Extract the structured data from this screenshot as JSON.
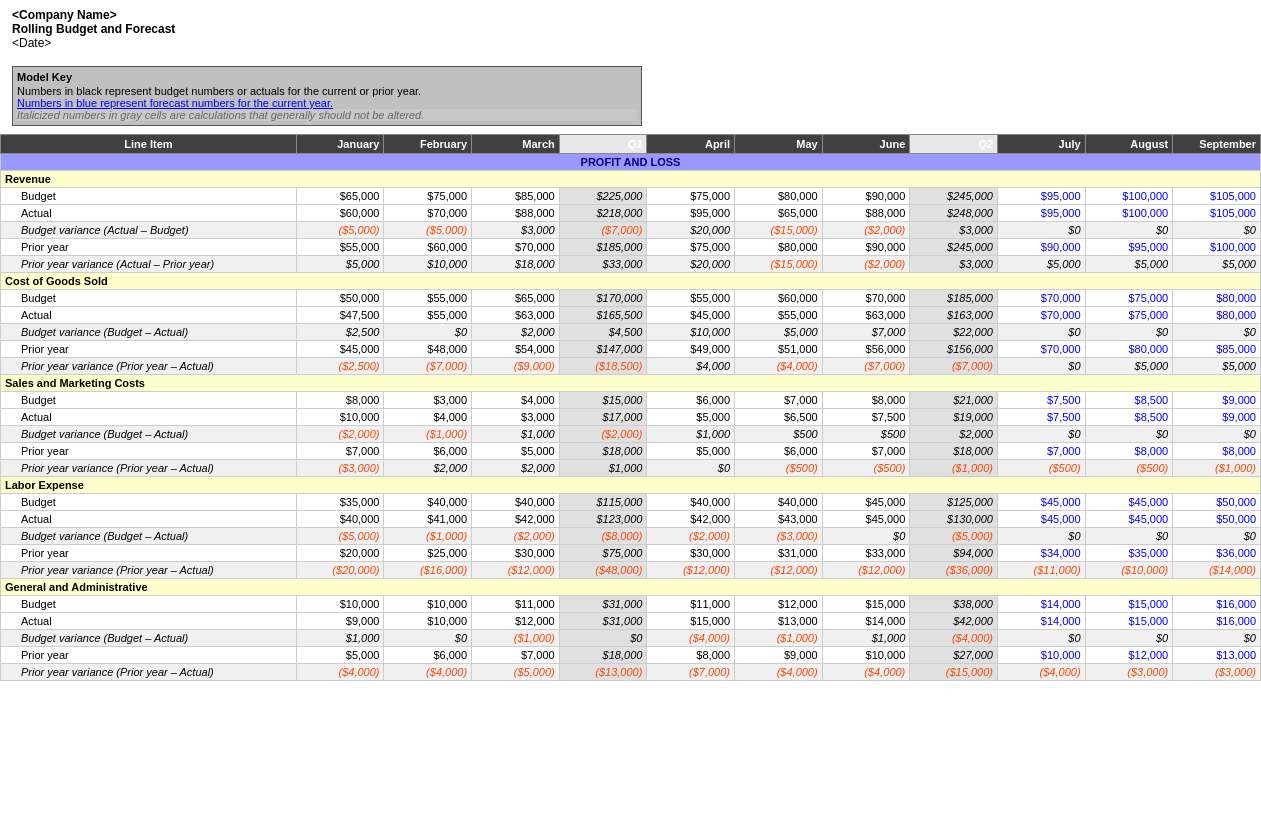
{
  "header": {
    "company": "<Company Name>",
    "title": "Rolling Budget and Forecast",
    "date": "<Date>"
  },
  "modelKey": {
    "title": "Model Key",
    "line1": "Numbers in black represent budget numbers or actuals for the current or prior year.",
    "line2": "Numbers in blue represent forecast numbers for the current year.",
    "line3": "Italicized numbers in gray cells are calculations that generally should not be altered."
  },
  "columns": [
    "Line Item",
    "January",
    "February",
    "March",
    "Q1",
    "April",
    "May",
    "June",
    "Q2",
    "July",
    "August",
    "September"
  ],
  "plHeader": "PROFIT AND LOSS",
  "sections": [
    {
      "name": "Revenue",
      "rows": [
        {
          "label": "Budget",
          "vals": [
            "$65,000",
            "$75,000",
            "$85,000",
            "$225,000",
            "$75,000",
            "$80,000",
            "$90,000",
            "$245,000",
            "$95,000",
            "$100,000",
            "$105,000"
          ],
          "type": "budget"
        },
        {
          "label": "Actual",
          "vals": [
            "$60,000",
            "$70,000",
            "$88,000",
            "$218,000",
            "$95,000",
            "$65,000",
            "$88,000",
            "$248,000",
            "$95,000",
            "$100,000",
            "$105,000"
          ],
          "type": "actual"
        },
        {
          "label": "Budget variance (Actual – Budget)",
          "vals": [
            "($5,000)",
            "($5,000)",
            "$3,000",
            "($7,000)",
            "$20,000",
            "($15,000)",
            "($2,000)",
            "$3,000",
            "$0",
            "$0",
            "$0"
          ],
          "type": "variance"
        },
        {
          "label": "Prior year",
          "vals": [
            "$55,000",
            "$60,000",
            "$70,000",
            "$185,000",
            "$75,000",
            "$80,000",
            "$90,000",
            "$245,000",
            "$90,000",
            "$95,000",
            "$100,000"
          ],
          "type": "prior"
        },
        {
          "label": "Prior year variance (Actual – Prior year)",
          "vals": [
            "$5,000",
            "$10,000",
            "$18,000",
            "$33,000",
            "$20,000",
            "($15,000)",
            "($2,000)",
            "$3,000",
            "$5,000",
            "$5,000",
            "$5,000"
          ],
          "type": "prior-variance"
        }
      ]
    },
    {
      "name": "Cost of Goods Sold",
      "rows": [
        {
          "label": "Budget",
          "vals": [
            "$50,000",
            "$55,000",
            "$65,000",
            "$170,000",
            "$55,000",
            "$60,000",
            "$70,000",
            "$185,000",
            "$70,000",
            "$75,000",
            "$80,000"
          ],
          "type": "budget"
        },
        {
          "label": "Actual",
          "vals": [
            "$47,500",
            "$55,000",
            "$63,000",
            "$165,500",
            "$45,000",
            "$55,000",
            "$63,000",
            "$163,000",
            "$70,000",
            "$75,000",
            "$80,000"
          ],
          "type": "actual"
        },
        {
          "label": "Budget variance (Budget – Actual)",
          "vals": [
            "$2,500",
            "$0",
            "$2,000",
            "$4,500",
            "$10,000",
            "$5,000",
            "$7,000",
            "$22,000",
            "$0",
            "$0",
            "$0"
          ],
          "type": "variance"
        },
        {
          "label": "Prior year",
          "vals": [
            "$45,000",
            "$48,000",
            "$54,000",
            "$147,000",
            "$49,000",
            "$51,000",
            "$56,000",
            "$156,000",
            "$70,000",
            "$80,000",
            "$85,000"
          ],
          "type": "prior"
        },
        {
          "label": "Prior year variance (Prior year – Actual)",
          "vals": [
            "($2,500)",
            "($7,000)",
            "($9,000)",
            "($18,500)",
            "$4,000",
            "($4,000)",
            "($7,000)",
            "($7,000)",
            "$0",
            "$5,000",
            "$5,000"
          ],
          "type": "prior-variance"
        }
      ]
    },
    {
      "name": "Sales and Marketing Costs",
      "rows": [
        {
          "label": "Budget",
          "vals": [
            "$8,000",
            "$3,000",
            "$4,000",
            "$15,000",
            "$6,000",
            "$7,000",
            "$8,000",
            "$21,000",
            "$7,500",
            "$8,500",
            "$9,000"
          ],
          "type": "budget"
        },
        {
          "label": "Actual",
          "vals": [
            "$10,000",
            "$4,000",
            "$3,000",
            "$17,000",
            "$5,000",
            "$6,500",
            "$7,500",
            "$19,000",
            "$7,500",
            "$8,500",
            "$9,000"
          ],
          "type": "actual"
        },
        {
          "label": "Budget variance (Budget – Actual)",
          "vals": [
            "($2,000)",
            "($1,000)",
            "$1,000",
            "($2,000)",
            "$1,000",
            "$500",
            "$500",
            "$2,000",
            "$0",
            "$0",
            "$0"
          ],
          "type": "variance"
        },
        {
          "label": "Prior year",
          "vals": [
            "$7,000",
            "$6,000",
            "$5,000",
            "$18,000",
            "$5,000",
            "$6,000",
            "$7,000",
            "$18,000",
            "$7,000",
            "$8,000",
            "$8,000"
          ],
          "type": "prior"
        },
        {
          "label": "Prior year variance (Prior year – Actual)",
          "vals": [
            "($3,000)",
            "$2,000",
            "$2,000",
            "$1,000",
            "$0",
            "($500)",
            "($500)",
            "($1,000)",
            "($500)",
            "($500)",
            "($1,000)"
          ],
          "type": "prior-variance"
        }
      ]
    },
    {
      "name": "Labor Expense",
      "rows": [
        {
          "label": "Budget",
          "vals": [
            "$35,000",
            "$40,000",
            "$40,000",
            "$115,000",
            "$40,000",
            "$40,000",
            "$45,000",
            "$125,000",
            "$45,000",
            "$45,000",
            "$50,000"
          ],
          "type": "budget"
        },
        {
          "label": "Actual",
          "vals": [
            "$40,000",
            "$41,000",
            "$42,000",
            "$123,000",
            "$42,000",
            "$43,000",
            "$45,000",
            "$130,000",
            "$45,000",
            "$45,000",
            "$50,000"
          ],
          "type": "actual"
        },
        {
          "label": "Budget variance (Budget – Actual)",
          "vals": [
            "($5,000)",
            "($1,000)",
            "($2,000)",
            "($8,000)",
            "($2,000)",
            "($3,000)",
            "$0",
            "($5,000)",
            "$0",
            "$0",
            "$0"
          ],
          "type": "variance"
        },
        {
          "label": "Prior year",
          "vals": [
            "$20,000",
            "$25,000",
            "$30,000",
            "$75,000",
            "$30,000",
            "$31,000",
            "$33,000",
            "$94,000",
            "$34,000",
            "$35,000",
            "$36,000"
          ],
          "type": "prior"
        },
        {
          "label": "Prior year variance (Prior year – Actual)",
          "vals": [
            "($20,000)",
            "($16,000)",
            "($12,000)",
            "($48,000)",
            "($12,000)",
            "($12,000)",
            "($12,000)",
            "($36,000)",
            "($11,000)",
            "($10,000)",
            "($14,000)"
          ],
          "type": "prior-variance"
        }
      ]
    },
    {
      "name": "General and Administrative",
      "rows": [
        {
          "label": "Budget",
          "vals": [
            "$10,000",
            "$10,000",
            "$11,000",
            "$31,000",
            "$11,000",
            "$12,000",
            "$15,000",
            "$38,000",
            "$14,000",
            "$15,000",
            "$16,000"
          ],
          "type": "budget"
        },
        {
          "label": "Actual",
          "vals": [
            "$9,000",
            "$10,000",
            "$12,000",
            "$31,000",
            "$15,000",
            "$13,000",
            "$14,000",
            "$42,000",
            "$14,000",
            "$15,000",
            "$16,000"
          ],
          "type": "actual"
        },
        {
          "label": "Budget variance (Budget – Actual)",
          "vals": [
            "$1,000",
            "$0",
            "($1,000)",
            "$0",
            "($4,000)",
            "($1,000)",
            "$1,000",
            "($4,000)",
            "$0",
            "$0",
            "$0"
          ],
          "type": "variance"
        },
        {
          "label": "Prior year",
          "vals": [
            "$5,000",
            "$6,000",
            "$7,000",
            "$18,000",
            "$8,000",
            "$9,000",
            "$10,000",
            "$27,000",
            "$10,000",
            "$12,000",
            "$13,000"
          ],
          "type": "prior"
        },
        {
          "label": "Prior year variance (Prior year – Actual)",
          "vals": [
            "($4,000)",
            "($4,000)",
            "($5,000)",
            "($13,000)",
            "($7,000)",
            "($4,000)",
            "($4,000)",
            "($15,000)",
            "($4,000)",
            "($3,000)",
            "($3,000)"
          ],
          "type": "prior-variance"
        }
      ]
    }
  ]
}
